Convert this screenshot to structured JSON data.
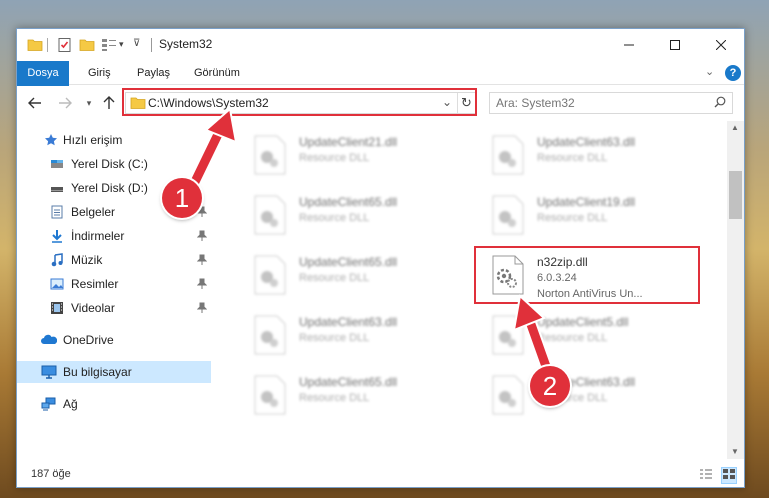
{
  "window": {
    "title": "System32"
  },
  "ribbon": {
    "tabs": [
      "Dosya",
      "Giriş",
      "Paylaş",
      "Görünüm"
    ],
    "help_label": "?"
  },
  "address": {
    "path": "C:\\Windows\\System32"
  },
  "search": {
    "placeholder": "Ara: System32"
  },
  "sidebar": {
    "items": [
      {
        "label": "Hızlı erişim",
        "icon": "star-icon"
      },
      {
        "label": "Yerel Disk (C:)",
        "icon": "drive-icon"
      },
      {
        "label": "Yerel Disk (D:)",
        "icon": "drive-icon"
      },
      {
        "label": "Belgeler",
        "icon": "documents-icon",
        "pinned": true
      },
      {
        "label": "İndirmeler",
        "icon": "download-icon",
        "pinned": true
      },
      {
        "label": "Müzik",
        "icon": "music-icon",
        "pinned": true
      },
      {
        "label": "Resimler",
        "icon": "pictures-icon",
        "pinned": true
      },
      {
        "label": "Videolar",
        "icon": "videos-icon",
        "pinned": true
      },
      {
        "label": "OneDrive",
        "icon": "onedrive-icon"
      },
      {
        "label": "Bu bilgisayar",
        "icon": "computer-icon",
        "selected": true
      },
      {
        "label": "Ağ",
        "icon": "network-icon"
      }
    ]
  },
  "files": [
    {
      "name": "UpdateClient21.dll",
      "type": "Resource DLL"
    },
    {
      "name": "UpdateClient63.dll",
      "type": "Resource DLL"
    },
    {
      "name": "UpdateClient65.dll",
      "type": "Resource DLL"
    },
    {
      "name": "UpdateClient19.dll",
      "type": "Resource DLL"
    },
    {
      "name": "UpdateClient65.dll",
      "type": "Resource DLL"
    },
    {
      "name": "n32zip.dll",
      "version": "6.0.3.24",
      "description": "Norton AntiVirus Un..."
    },
    {
      "name": "UpdateClient63.dll",
      "type": "Resource DLL"
    },
    {
      "name": "UpdateClient5.dll",
      "type": "Resource DLL"
    },
    {
      "name": "UpdateClient65.dll",
      "type": "Resource DLL"
    },
    {
      "name": "UpdateClient63.dll",
      "type": "Resource DLL"
    }
  ],
  "status": {
    "item_count": "187 öğe"
  },
  "annotations": {
    "step1": "1",
    "step2": "2"
  },
  "colors": {
    "accent": "#1979ca",
    "highlight": "#e0303a",
    "selected_bg": "#cce8ff"
  }
}
